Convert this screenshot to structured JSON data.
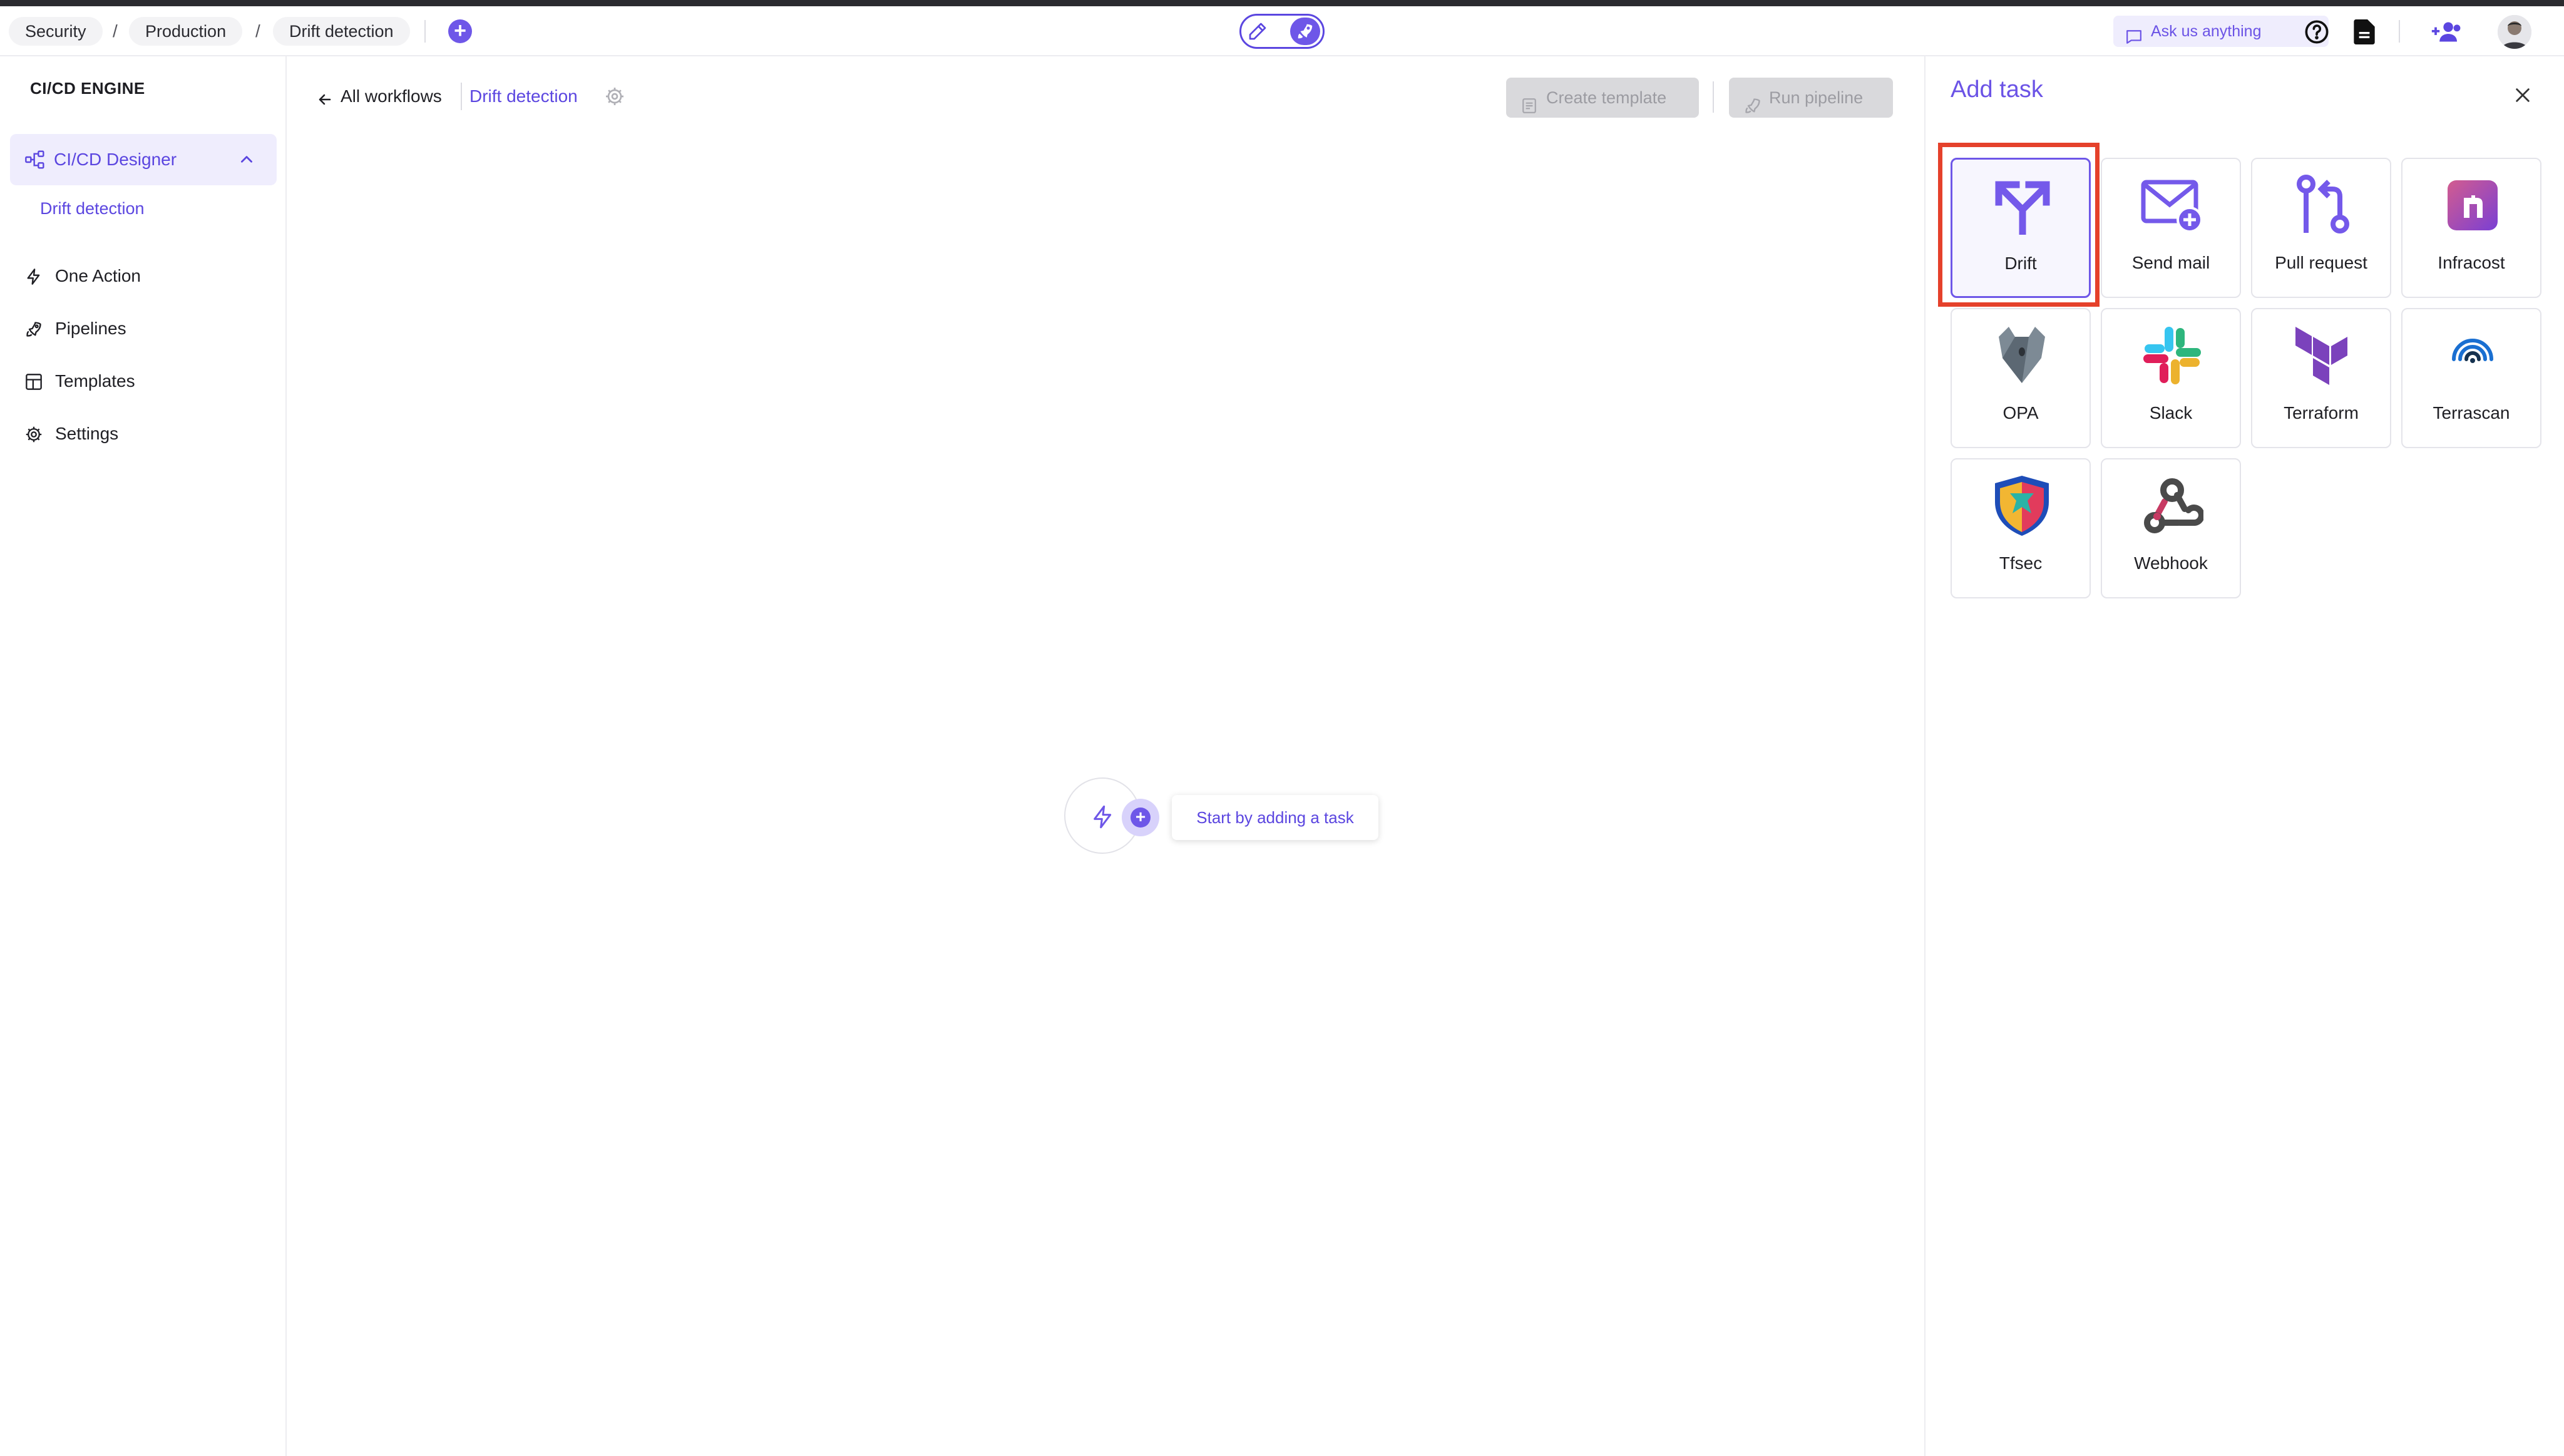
{
  "breadcrumbs": [
    "Security",
    "Production",
    "Drift detection"
  ],
  "breadcrumb_separator": "/",
  "header": {
    "ask_label": "Ask us anything"
  },
  "sidebar": {
    "engine_title": "CI/CD ENGINE",
    "designer_label": "CI/CD Designer",
    "designer_sub": "Drift detection",
    "items": [
      {
        "label": "One Action",
        "icon": "bolt-icon"
      },
      {
        "label": "Pipelines",
        "icon": "rocket-icon"
      },
      {
        "label": "Templates",
        "icon": "templates-icon"
      },
      {
        "label": "Settings",
        "icon": "gear-icon"
      }
    ]
  },
  "main": {
    "back_label": "All workflows",
    "workflow_name": "Drift detection",
    "create_template_label": "Create template",
    "run_pipeline_label": "Run pipeline",
    "start_hint": "Start by adding a task"
  },
  "panel": {
    "title": "Add task",
    "tasks": [
      {
        "label": "Drift",
        "icon": "drift-icon",
        "selected": true
      },
      {
        "label": "Send mail",
        "icon": "send-mail-icon"
      },
      {
        "label": "Pull request",
        "icon": "pull-request-icon"
      },
      {
        "label": "Infracost",
        "icon": "infracost-icon"
      },
      {
        "label": "OPA",
        "icon": "opa-icon"
      },
      {
        "label": "Slack",
        "icon": "slack-icon"
      },
      {
        "label": "Terraform",
        "icon": "terraform-icon"
      },
      {
        "label": "Terrascan",
        "icon": "terrascan-icon"
      },
      {
        "label": "Tfsec",
        "icon": "tfsec-icon"
      },
      {
        "label": "Webhook",
        "icon": "webhook-icon"
      }
    ]
  },
  "colors": {
    "accent": "#6e57e8",
    "highlight": "#e5412b"
  }
}
